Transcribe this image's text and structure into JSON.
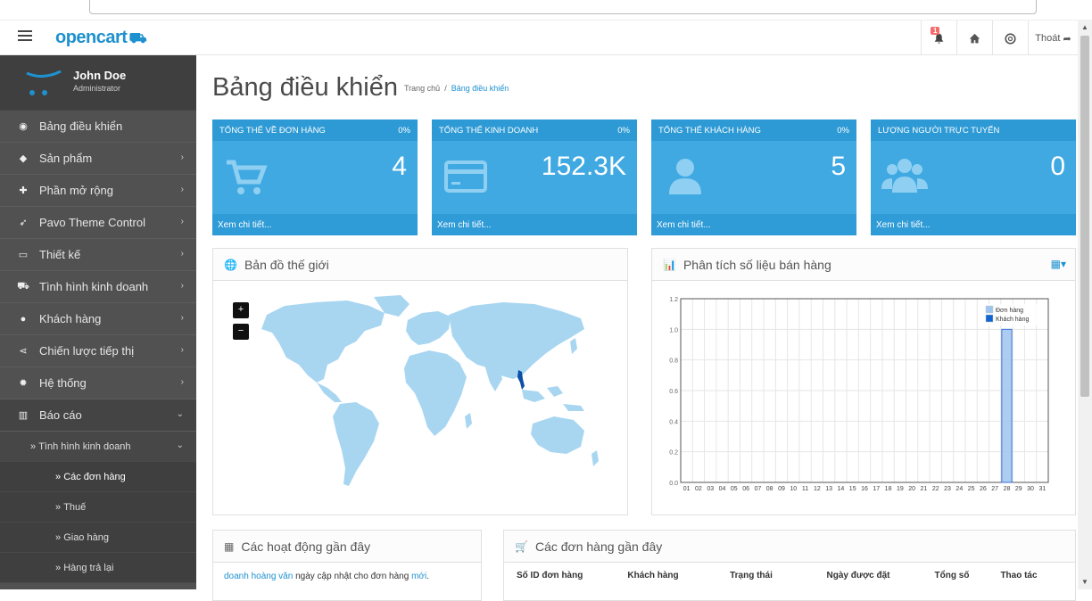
{
  "header": {
    "logo_text": "opencart",
    "notification_count": "1",
    "logout_label": "Thoát"
  },
  "profile": {
    "name": "John Doe",
    "role": "Administrator"
  },
  "sidebar": {
    "items": [
      {
        "label": "Bảng điều khiển",
        "icon": "dashboard-icon"
      },
      {
        "label": "Sản phẩm",
        "icon": "tag-icon"
      },
      {
        "label": "Phần mở rộng",
        "icon": "puzzle-icon"
      },
      {
        "label": "Pavo Theme Control",
        "icon": "rocket-icon"
      },
      {
        "label": "Thiết kế",
        "icon": "monitor-icon"
      },
      {
        "label": "Tình hình kinh doanh",
        "icon": "cart-icon"
      },
      {
        "label": "Khách hàng",
        "icon": "user-icon"
      },
      {
        "label": "Chiến lược tiếp thị",
        "icon": "share-icon"
      },
      {
        "label": "Hệ thống",
        "icon": "cog-icon"
      },
      {
        "label": "Báo cáo",
        "icon": "bar-chart-icon"
      }
    ],
    "sub_l1": "Tình hình kinh doanh",
    "sub_l2": [
      "Các đơn hàng",
      "Thuế",
      "Giao hàng",
      "Hàng trả lại"
    ]
  },
  "page": {
    "title": "Bảng điều khiển",
    "breadcrumb_home": "Trang chủ",
    "breadcrumb_sep": "/",
    "breadcrumb_current": "Bảng điều khiển"
  },
  "tiles": [
    {
      "title": "Tổng thể về đơn hàng",
      "percent": "0%",
      "value": "4",
      "footer": "Xem chi tiết...",
      "icon": "cart-icon"
    },
    {
      "title": "Tổng thể kinh doanh",
      "percent": "0%",
      "value": "152.3K",
      "footer": "Xem chi tiết...",
      "icon": "credit-card-icon"
    },
    {
      "title": "Tổng thể khách hàng",
      "percent": "0%",
      "value": "5",
      "footer": "Xem chi tiết...",
      "icon": "user-icon"
    },
    {
      "title": "Lượng người trực tuyến",
      "percent": "",
      "value": "0",
      "footer": "Xem chi tiết...",
      "icon": "users-icon"
    }
  ],
  "map_panel": {
    "title": "Bản đồ thế giới",
    "zoom_in": "+",
    "zoom_out": "−"
  },
  "sales_panel": {
    "title": "Phân tích số liệu bán hàng"
  },
  "chart_data": {
    "type": "bar",
    "x": [
      "01",
      "02",
      "03",
      "04",
      "05",
      "06",
      "07",
      "08",
      "09",
      "10",
      "11",
      "12",
      "13",
      "14",
      "15",
      "16",
      "17",
      "18",
      "19",
      "20",
      "21",
      "22",
      "23",
      "24",
      "25",
      "26",
      "27",
      "28",
      "29",
      "30",
      "31"
    ],
    "series": [
      {
        "name": "Đơn hàng",
        "color": "#9ec4ef",
        "values": [
          0,
          0,
          0,
          0,
          0,
          0,
          0,
          0,
          0,
          0,
          0,
          0,
          0,
          0,
          0,
          0,
          0,
          0,
          0,
          0,
          0,
          0,
          0,
          0,
          0,
          0,
          0,
          1,
          0,
          0,
          0
        ]
      },
      {
        "name": "Khách hàng",
        "color": "#1065d2",
        "values": [
          0,
          0,
          0,
          0,
          0,
          0,
          0,
          0,
          0,
          0,
          0,
          0,
          0,
          0,
          0,
          0,
          0,
          0,
          0,
          0,
          0,
          0,
          0,
          0,
          0,
          0,
          0,
          0,
          0,
          0,
          0
        ]
      }
    ],
    "yticks": [
      "0.0",
      "0.2",
      "0.4",
      "0.6",
      "0.8",
      "1.0",
      "1.2"
    ],
    "ylim": [
      0,
      1.2
    ],
    "grid": true,
    "legend": "top-right"
  },
  "activity_panel": {
    "title": "Các hoạt động gần đây",
    "entry_user": "doanh hoàng văn",
    "entry_text": " ngày cập nhật cho đơn hàng ",
    "entry_link": "mới",
    "entry_end": "."
  },
  "orders_panel": {
    "title": "Các đơn hàng gần đây",
    "columns": [
      "Số ID đơn hàng",
      "Khách hàng",
      "Trạng thái",
      "Ngày được đặt",
      "Tổng số",
      "Thao tác"
    ]
  }
}
